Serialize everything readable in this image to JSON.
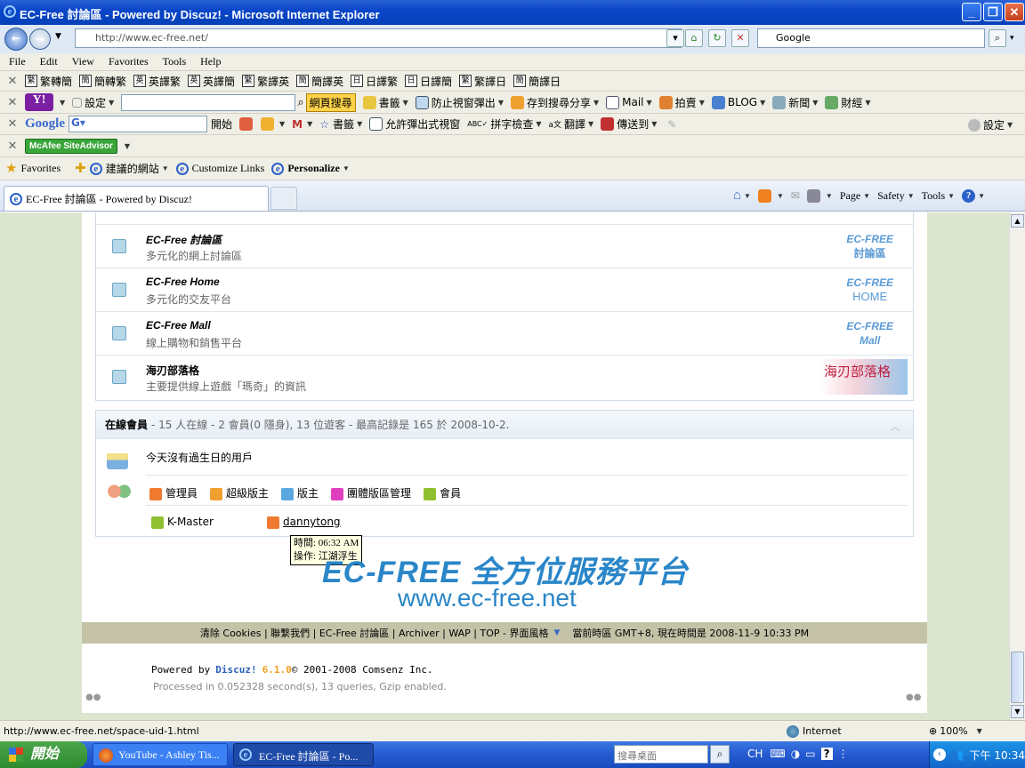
{
  "window": {
    "title": "EC-Free 討論區 - Powered by Discuz! - Microsoft Internet Explorer"
  },
  "address": {
    "url": "http://www.ec-free.net/",
    "search_placeholder": "Google"
  },
  "menu": [
    "File",
    "Edit",
    "View",
    "Favorites",
    "Tools",
    "Help"
  ],
  "translate_toolbar": [
    "繁轉簡",
    "簡轉繁",
    "英譯繁",
    "英譯簡",
    "繁譯英",
    "簡譯英",
    "日譯繁",
    "日譯簡",
    "繁譯日",
    "簡譯日"
  ],
  "yahoo_toolbar": {
    "settings": "設定",
    "search_button": "網頁搜尋",
    "items": [
      "書籤",
      "防止視窗彈出",
      "存到搜尋分享",
      "Mail",
      "拍賣",
      "BLOG",
      "新聞",
      "財經"
    ]
  },
  "google_toolbar": {
    "start": "開始",
    "bookmarks": "書籤",
    "popup": "允許彈出式視窗",
    "spell": "拼字檢查",
    "translate": "翻譯",
    "send": "傳送到",
    "settings": "設定"
  },
  "mcafee": {
    "label": "McAfee SiteAdvisor"
  },
  "favorites": {
    "label": "Favorites",
    "items": [
      "建議的網站",
      "Customize Links",
      "Personalize"
    ]
  },
  "tab": {
    "title": "EC-Free 討論區 - Powered by Discuz!"
  },
  "command_bar": [
    "Page",
    "Safety",
    "Tools"
  ],
  "forums": [
    {
      "name": "EC-Free 討論區",
      "desc": "多元化的網上討論區",
      "logo_top": "EC-FREE",
      "logo_bottom": "討論區"
    },
    {
      "name": "EC-Free Home",
      "desc": "多元化的交友平台",
      "logo_top": "EC-FREE",
      "logo_bottom": "HOME"
    },
    {
      "name": "EC-Free Mall",
      "desc": "線上購物和銷售平台",
      "logo_top": "EC-FREE",
      "logo_bottom": "Mall"
    },
    {
      "name": "海刃部落格",
      "desc": "主要提供線上遊戲「瑪奇」的資訊",
      "logo_top": "海刃部落格",
      "logo_bottom": ""
    }
  ],
  "online": {
    "title": "在線會員",
    "stats": "- 15 人在線 - 2 會員(0 隱身), 13 位遊客 - 最高記錄是 165 於 2008-10-2.",
    "birthday": "今天沒有過生日的用戶",
    "legend": [
      "管理員",
      "超級版主",
      "版主",
      "團體版區管理",
      "會員"
    ],
    "legend_colors": [
      "#f07a30",
      "#f0a030",
      "#5aa8e0",
      "#e040c0",
      "#90c030"
    ],
    "members": [
      {
        "name": "K-Master",
        "color": "#90c030"
      },
      {
        "name": "dannytong",
        "color": "#f07a30"
      }
    ]
  },
  "tooltip": {
    "line1": "時間: 06:32 AM",
    "line2": "操作: 江湖浮生"
  },
  "brand": {
    "line1": "EC-FREE 全方位服務平台",
    "line2": "www.ec-free.net"
  },
  "footer": {
    "links": "清除 Cookies | 聯繫我們 | EC-Free 討論區 | Archiver | WAP | TOP - 界面風格",
    "time": "當前時區 GMT+8, 現在時間是 2008-11-9 10:33 PM",
    "powered_by": "Powered by",
    "discuz": "Discuz!",
    "version": "6.1.0",
    "copyright": "© 2001-2008 Comsenz Inc.",
    "processed": "Processed in 0.052328 second(s), 13 queries, Gzip enabled."
  },
  "status": {
    "url": "http://www.ec-free.net/space-uid-1.html",
    "zone": "Internet",
    "zoom": "100%"
  },
  "taskbar": {
    "start": "開始",
    "tasks": [
      "YouTube - Ashley Tis...",
      "EC-Free 討論區 - Po..."
    ],
    "search": "搜尋桌面",
    "lang": "CH",
    "clock": "下午 10:34"
  }
}
